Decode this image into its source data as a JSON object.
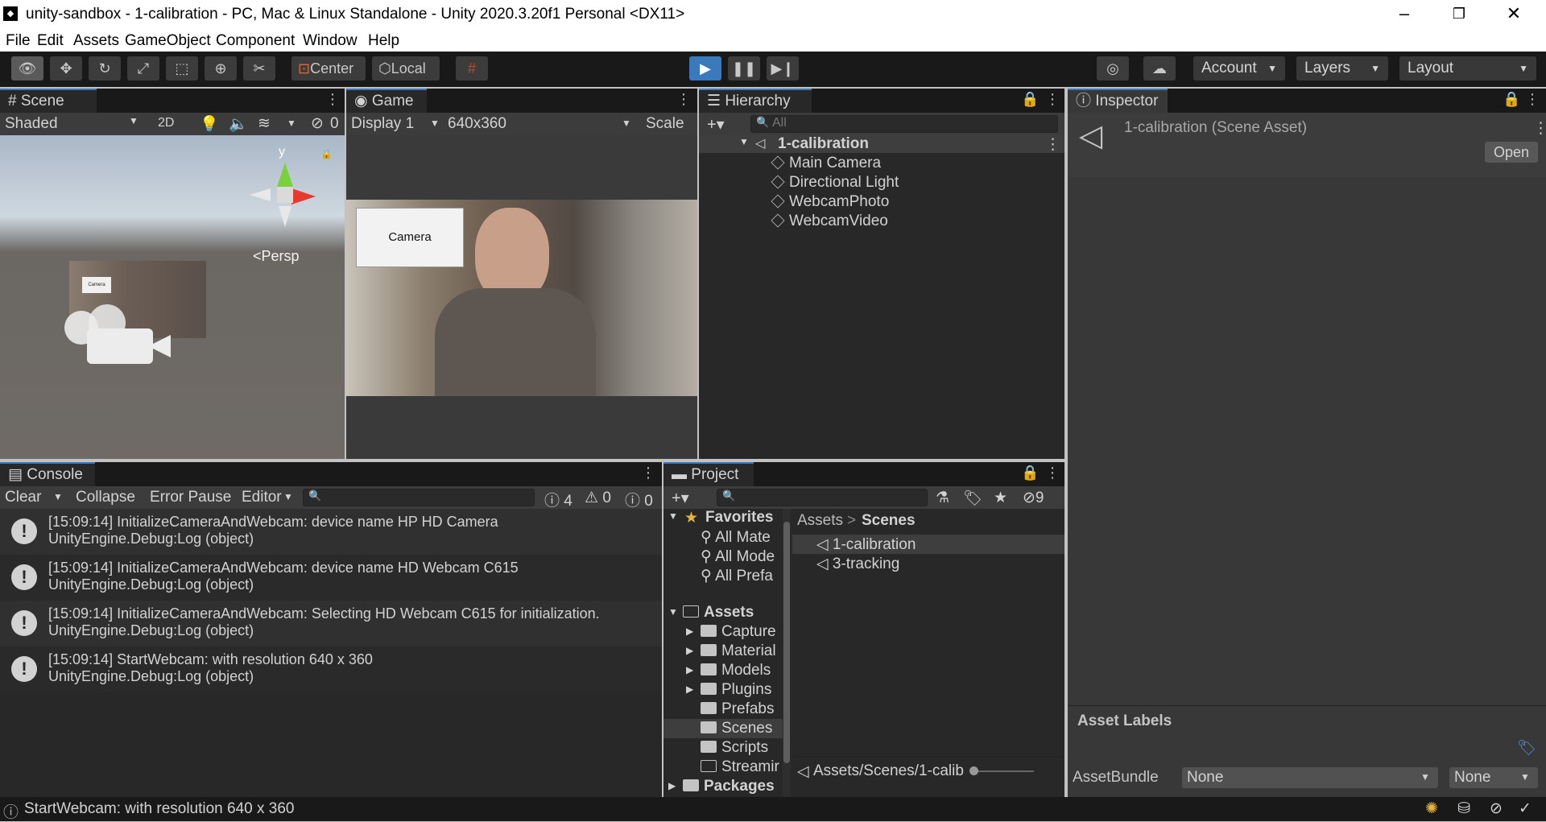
{
  "window": {
    "title": "unity-sandbox - 1-calibration - PC, Mac & Linux Standalone - Unity 2020.3.20f1 Personal <DX11>",
    "minimize": "–",
    "restore": "❐",
    "close": "✕"
  },
  "menu": [
    "File",
    "Edit",
    "Assets",
    "GameObject",
    "Component",
    "Window",
    "Help"
  ],
  "toolbar": {
    "pivot": "Center",
    "space": "Local",
    "account": "Account",
    "layers": "Layers",
    "layout": "Layout"
  },
  "scene": {
    "tab": "Scene",
    "shading": "Shaded",
    "mode2d": "2D",
    "hidden_count": "0",
    "axis_y": "y",
    "persp": "<Persp",
    "camera_label": "Camera"
  },
  "game": {
    "tab": "Game",
    "display": "Display 1",
    "resolution": "640x360",
    "scale": "Scale",
    "button_label": "Camera"
  },
  "hierarchy": {
    "tab": "Hierarchy",
    "search_placeholder": "All",
    "scene_name": "1-calibration",
    "objects": [
      "Main Camera",
      "Directional Light",
      "WebcamPhoto",
      "WebcamVideo"
    ]
  },
  "inspector": {
    "tab": "Inspector",
    "asset_title": "1-calibration (Scene Asset)",
    "open_button": "Open",
    "asset_labels": "Asset Labels",
    "asset_bundle_label": "AssetBundle",
    "bundle_value": "None",
    "variant_value": "None"
  },
  "console": {
    "tab": "Console",
    "clear": "Clear",
    "collapse": "Collapse",
    "error_pause": "Error Pause",
    "editor": "Editor",
    "count_log": "4",
    "count_warn": "0",
    "count_err": "0",
    "messages": [
      {
        "line1": "[15:09:14] InitializeCameraAndWebcam: device name HP HD Camera",
        "line2": "UnityEngine.Debug:Log (object)"
      },
      {
        "line1": "[15:09:14] InitializeCameraAndWebcam: device name HD Webcam C615",
        "line2": "UnityEngine.Debug:Log (object)"
      },
      {
        "line1": "[15:09:14] InitializeCameraAndWebcam: Selecting HD Webcam C615 for initialization.",
        "line2": "UnityEngine.Debug:Log (object)"
      },
      {
        "line1": "[15:09:14] StartWebcam: with resolution 640 x 360",
        "line2": "UnityEngine.Debug:Log (object)"
      }
    ]
  },
  "project": {
    "tab": "Project",
    "hidden_count": "9",
    "favorites": "Favorites",
    "fav_items": [
      "All Mate",
      "All Mode",
      "All Prefa"
    ],
    "assets_root": "Assets",
    "folders": [
      "Capture",
      "Material",
      "Models",
      "Plugins",
      "Prefabs",
      "Scenes",
      "Scripts",
      "Streamir"
    ],
    "packages": "Packages",
    "breadcrumb_root": "Assets",
    "breadcrumb_sep": ">",
    "breadcrumb_current": "Scenes",
    "files": [
      "1-calibration",
      "3-tracking"
    ],
    "path": "Assets/Scenes/1-calib"
  },
  "status": {
    "text": "StartWebcam: with resolution 640 x 360"
  },
  "colors": {
    "accent_blue": "#3a79bb",
    "panel": "#282828",
    "toolbar": "#191919"
  }
}
